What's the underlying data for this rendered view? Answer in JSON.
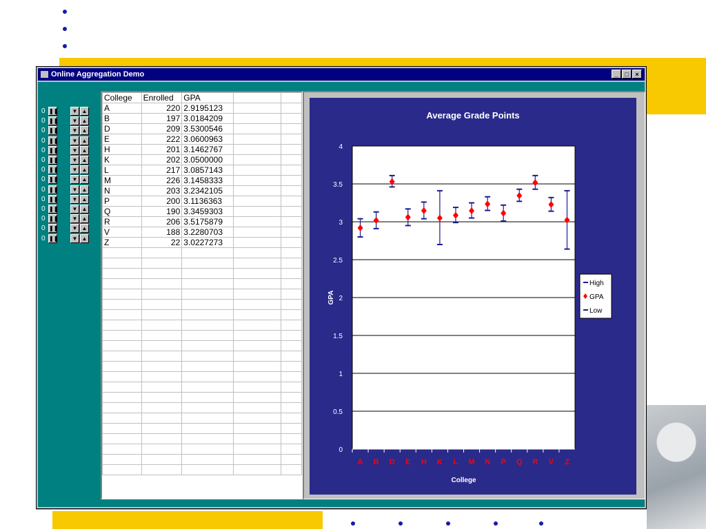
{
  "window": {
    "title": "Online Aggregation Demo",
    "buttons": {
      "minimize": "_",
      "maximize": "□",
      "close": "×"
    }
  },
  "controls": {
    "count_label": "0",
    "pause_icon": "pause-icon",
    "down_icon": "triangle-down-icon",
    "up_icon": "triangle-up-icon"
  },
  "table": {
    "columns": [
      "College",
      "Enrolled",
      "GPA"
    ],
    "rows": [
      [
        "A",
        "220",
        "2.9195123"
      ],
      [
        "B",
        "197",
        "3.0184209"
      ],
      [
        "D",
        "209",
        "3.5300546"
      ],
      [
        "E",
        "222",
        "3.0600963"
      ],
      [
        "H",
        "201",
        "3.1462767"
      ],
      [
        "K",
        "202",
        "3.0500000"
      ],
      [
        "L",
        "217",
        "3.0857143"
      ],
      [
        "M",
        "226",
        "3.1458333"
      ],
      [
        "N",
        "203",
        "3.2342105"
      ],
      [
        "P",
        "200",
        "3.1136363"
      ],
      [
        "Q",
        "190",
        "3.3459303"
      ],
      [
        "R",
        "206",
        "3.5175879"
      ],
      [
        "V",
        "188",
        "3.2280703"
      ],
      [
        "Z",
        "22",
        "3.0227273"
      ]
    ]
  },
  "chart_data": {
    "type": "scatter",
    "title": "Average Grade Points",
    "xlabel": "College",
    "ylabel": "GPA",
    "categories": [
      "A",
      "B",
      "D",
      "E",
      "H",
      "K",
      "L",
      "M",
      "N",
      "P",
      "Q",
      "R",
      "V",
      "Z"
    ],
    "series": [
      {
        "name": "High",
        "values": [
          3.04,
          3.13,
          3.61,
          3.17,
          3.26,
          3.41,
          3.19,
          3.25,
          3.33,
          3.22,
          3.43,
          3.61,
          3.32,
          3.41
        ]
      },
      {
        "name": "GPA",
        "values": [
          2.9195,
          3.0184,
          3.5301,
          3.0601,
          3.1463,
          3.05,
          3.0857,
          3.1458,
          3.2342,
          3.1136,
          3.3459,
          3.5176,
          3.2281,
          3.0227
        ]
      },
      {
        "name": "Low",
        "values": [
          2.8,
          2.91,
          3.46,
          2.95,
          3.04,
          2.7,
          2.99,
          3.05,
          3.15,
          3.01,
          3.27,
          3.43,
          3.14,
          2.64
        ]
      }
    ],
    "yticks": [
      "0",
      "0.5",
      "1",
      "1.5",
      "2",
      "2.5",
      "3",
      "3.5",
      "4"
    ],
    "ylim": [
      0,
      4
    ],
    "grid": true,
    "legend": "right",
    "colors": {
      "background": "#2a2a8a",
      "plot": "#ffffff",
      "gpa_marker": "#ff0000",
      "errorbar": "#1a1a90",
      "category_labels": "#ff0000",
      "legend_bg": "#ffffff"
    }
  }
}
